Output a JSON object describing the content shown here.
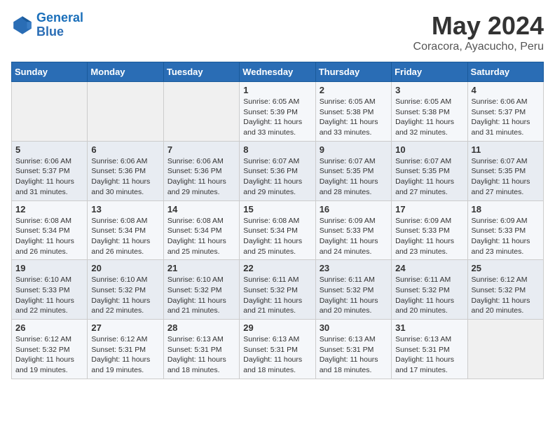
{
  "logo": {
    "line1": "General",
    "line2": "Blue"
  },
  "title": "May 2024",
  "location": "Coracora, Ayacucho, Peru",
  "days_of_week": [
    "Sunday",
    "Monday",
    "Tuesday",
    "Wednesday",
    "Thursday",
    "Friday",
    "Saturday"
  ],
  "weeks": [
    [
      {
        "day": "",
        "info": ""
      },
      {
        "day": "",
        "info": ""
      },
      {
        "day": "",
        "info": ""
      },
      {
        "day": "1",
        "info": "Sunrise: 6:05 AM\nSunset: 5:39 PM\nDaylight: 11 hours\nand 33 minutes."
      },
      {
        "day": "2",
        "info": "Sunrise: 6:05 AM\nSunset: 5:38 PM\nDaylight: 11 hours\nand 33 minutes."
      },
      {
        "day": "3",
        "info": "Sunrise: 6:05 AM\nSunset: 5:38 PM\nDaylight: 11 hours\nand 32 minutes."
      },
      {
        "day": "4",
        "info": "Sunrise: 6:06 AM\nSunset: 5:37 PM\nDaylight: 11 hours\nand 31 minutes."
      }
    ],
    [
      {
        "day": "5",
        "info": "Sunrise: 6:06 AM\nSunset: 5:37 PM\nDaylight: 11 hours\nand 31 minutes."
      },
      {
        "day": "6",
        "info": "Sunrise: 6:06 AM\nSunset: 5:36 PM\nDaylight: 11 hours\nand 30 minutes."
      },
      {
        "day": "7",
        "info": "Sunrise: 6:06 AM\nSunset: 5:36 PM\nDaylight: 11 hours\nand 29 minutes."
      },
      {
        "day": "8",
        "info": "Sunrise: 6:07 AM\nSunset: 5:36 PM\nDaylight: 11 hours\nand 29 minutes."
      },
      {
        "day": "9",
        "info": "Sunrise: 6:07 AM\nSunset: 5:35 PM\nDaylight: 11 hours\nand 28 minutes."
      },
      {
        "day": "10",
        "info": "Sunrise: 6:07 AM\nSunset: 5:35 PM\nDaylight: 11 hours\nand 27 minutes."
      },
      {
        "day": "11",
        "info": "Sunrise: 6:07 AM\nSunset: 5:35 PM\nDaylight: 11 hours\nand 27 minutes."
      }
    ],
    [
      {
        "day": "12",
        "info": "Sunrise: 6:08 AM\nSunset: 5:34 PM\nDaylight: 11 hours\nand 26 minutes."
      },
      {
        "day": "13",
        "info": "Sunrise: 6:08 AM\nSunset: 5:34 PM\nDaylight: 11 hours\nand 26 minutes."
      },
      {
        "day": "14",
        "info": "Sunrise: 6:08 AM\nSunset: 5:34 PM\nDaylight: 11 hours\nand 25 minutes."
      },
      {
        "day": "15",
        "info": "Sunrise: 6:08 AM\nSunset: 5:34 PM\nDaylight: 11 hours\nand 25 minutes."
      },
      {
        "day": "16",
        "info": "Sunrise: 6:09 AM\nSunset: 5:33 PM\nDaylight: 11 hours\nand 24 minutes."
      },
      {
        "day": "17",
        "info": "Sunrise: 6:09 AM\nSunset: 5:33 PM\nDaylight: 11 hours\nand 23 minutes."
      },
      {
        "day": "18",
        "info": "Sunrise: 6:09 AM\nSunset: 5:33 PM\nDaylight: 11 hours\nand 23 minutes."
      }
    ],
    [
      {
        "day": "19",
        "info": "Sunrise: 6:10 AM\nSunset: 5:33 PM\nDaylight: 11 hours\nand 22 minutes."
      },
      {
        "day": "20",
        "info": "Sunrise: 6:10 AM\nSunset: 5:32 PM\nDaylight: 11 hours\nand 22 minutes."
      },
      {
        "day": "21",
        "info": "Sunrise: 6:10 AM\nSunset: 5:32 PM\nDaylight: 11 hours\nand 21 minutes."
      },
      {
        "day": "22",
        "info": "Sunrise: 6:11 AM\nSunset: 5:32 PM\nDaylight: 11 hours\nand 21 minutes."
      },
      {
        "day": "23",
        "info": "Sunrise: 6:11 AM\nSunset: 5:32 PM\nDaylight: 11 hours\nand 20 minutes."
      },
      {
        "day": "24",
        "info": "Sunrise: 6:11 AM\nSunset: 5:32 PM\nDaylight: 11 hours\nand 20 minutes."
      },
      {
        "day": "25",
        "info": "Sunrise: 6:12 AM\nSunset: 5:32 PM\nDaylight: 11 hours\nand 20 minutes."
      }
    ],
    [
      {
        "day": "26",
        "info": "Sunrise: 6:12 AM\nSunset: 5:32 PM\nDaylight: 11 hours\nand 19 minutes."
      },
      {
        "day": "27",
        "info": "Sunrise: 6:12 AM\nSunset: 5:31 PM\nDaylight: 11 hours\nand 19 minutes."
      },
      {
        "day": "28",
        "info": "Sunrise: 6:13 AM\nSunset: 5:31 PM\nDaylight: 11 hours\nand 18 minutes."
      },
      {
        "day": "29",
        "info": "Sunrise: 6:13 AM\nSunset: 5:31 PM\nDaylight: 11 hours\nand 18 minutes."
      },
      {
        "day": "30",
        "info": "Sunrise: 6:13 AM\nSunset: 5:31 PM\nDaylight: 11 hours\nand 18 minutes."
      },
      {
        "day": "31",
        "info": "Sunrise: 6:13 AM\nSunset: 5:31 PM\nDaylight: 11 hours\nand 17 minutes."
      },
      {
        "day": "",
        "info": ""
      }
    ]
  ]
}
